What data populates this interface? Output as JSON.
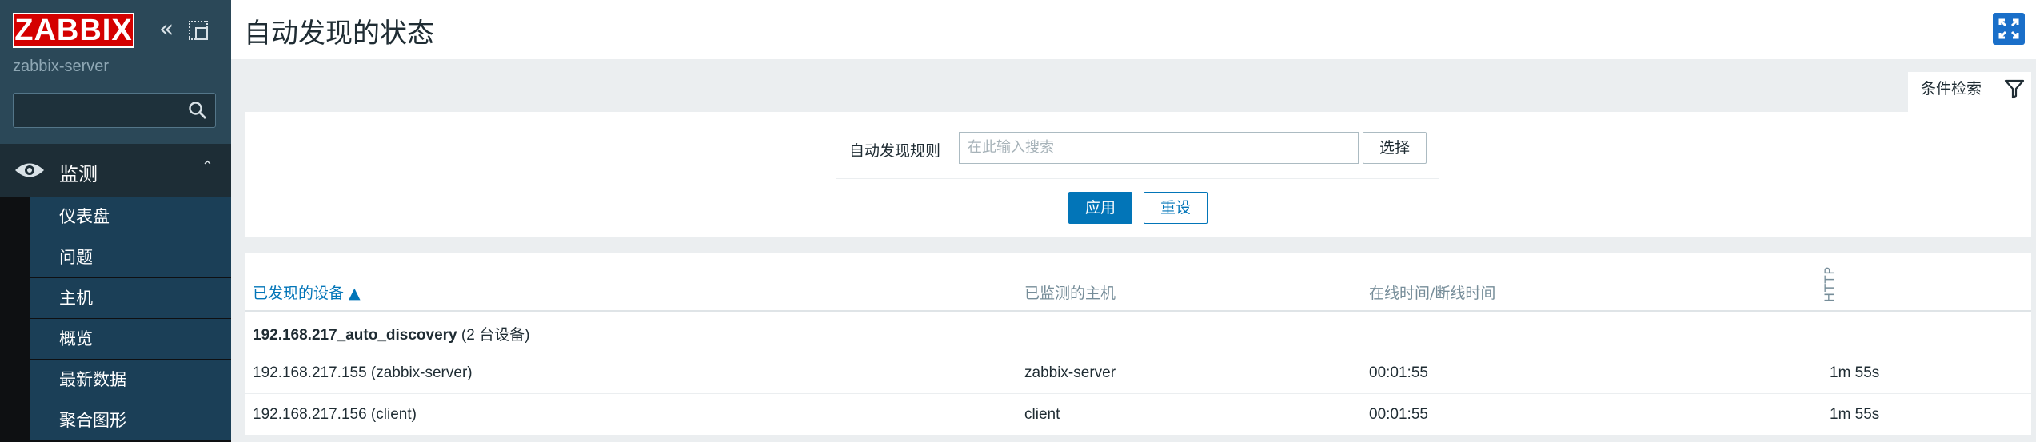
{
  "sidebar": {
    "logo_text": "ZABBIX",
    "server_name": "zabbix-server",
    "search_value": "",
    "section_label": "监测",
    "items": [
      {
        "label": "仪表盘"
      },
      {
        "label": "问题"
      },
      {
        "label": "主机"
      },
      {
        "label": "概览"
      },
      {
        "label": "最新数据"
      },
      {
        "label": "聚合图形"
      }
    ]
  },
  "header": {
    "title": "自动发现的状态"
  },
  "filter": {
    "tab_label": "条件检索",
    "rule_label": "自动发现规则",
    "rule_placeholder": "在此输入搜索",
    "select_label": "选择",
    "apply_label": "应用",
    "reset_label": "重设"
  },
  "table": {
    "columns": [
      "已发现的设备 ▲",
      "已监测的主机",
      "在线时间/断线时间",
      "HTTP"
    ],
    "group": {
      "name": "192.168.217_auto_discovery",
      "count": "(2 台设备)"
    },
    "rows": [
      {
        "device": "192.168.217.155 (zabbix-server)",
        "host": "zabbix-server",
        "uptime": "00:01:55",
        "http": "1m 55s"
      },
      {
        "device": "192.168.217.156 (client)",
        "host": "client",
        "uptime": "00:01:55",
        "http": "1m 55s"
      }
    ]
  },
  "colors": {
    "brand": "#d40000",
    "sidebar": "#2b4858",
    "accent": "#0275b8"
  }
}
